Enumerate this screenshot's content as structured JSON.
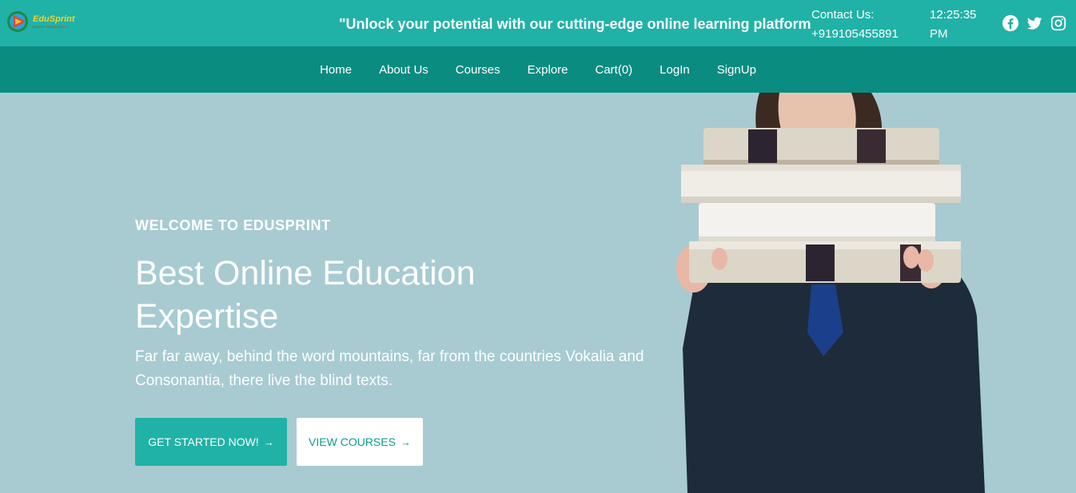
{
  "brand": {
    "name": "EduSprint",
    "tagline": "BOOST YOUR SKILLS"
  },
  "topbar": {
    "marquee": "\"Unlock your potential with our cutting-edge online learning platform",
    "contact_label": "Contact Us:",
    "contact_phone": "+919105455891",
    "clock_time": "12:25:35",
    "clock_period": "PM",
    "social": [
      "facebook-icon",
      "twitter-icon",
      "instagram-icon"
    ]
  },
  "nav": {
    "items": [
      "Home",
      "About Us",
      "Courses",
      "Explore",
      "Cart(0)",
      "LogIn",
      "SignUp"
    ]
  },
  "hero": {
    "eyebrow": "WELCOME TO EDUSPRINT",
    "headline_line1": "Best Online Education",
    "headline_line2": "Expertise",
    "subtitle": "Far far away, behind the word mountains, far from the countries Vokalia and Consonantia, there live the blind texts.",
    "primary_button": "GET STARTED NOW!",
    "secondary_button": "VIEW COURSES",
    "arrow": "→"
  },
  "colors": {
    "topbar": "#20b2a6",
    "nav": "#0a8c80",
    "hero_bg": "#a7cbd1",
    "accent": "#20b2a6"
  }
}
